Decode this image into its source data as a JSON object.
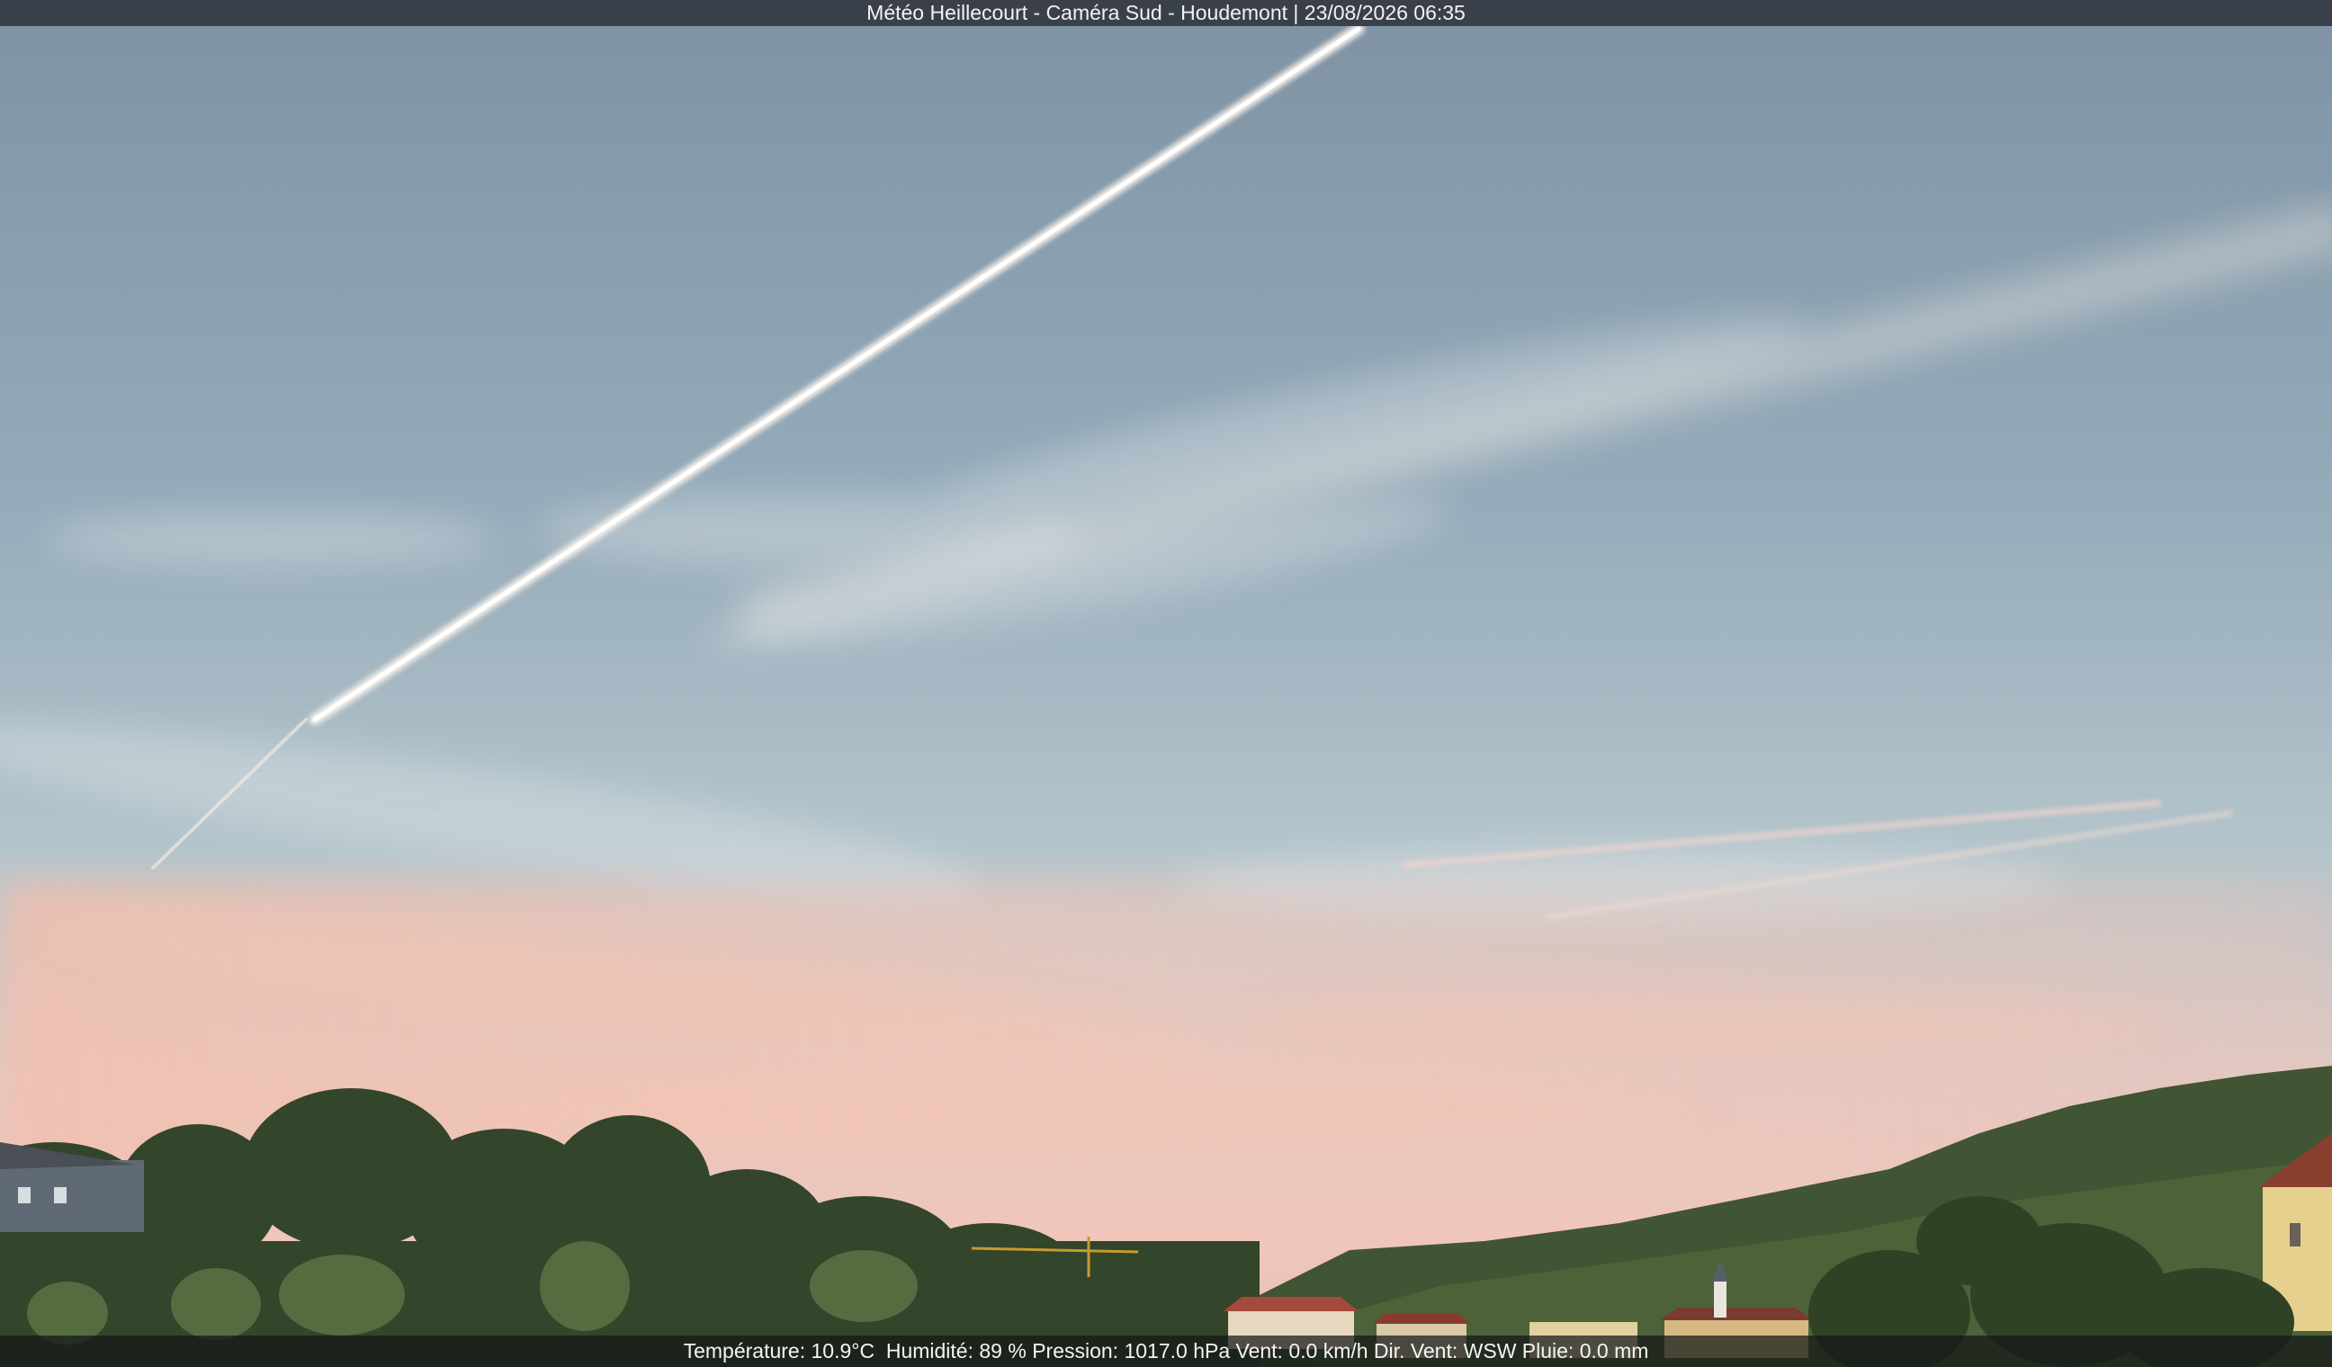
{
  "header": {
    "station": "Météo Heillecourt",
    "camera": "Caméra Sud",
    "location": "Houdemont",
    "datetime": "23/08/2026 06:35",
    "title": "Météo Heillecourt - Caméra Sud - Houdemont | 23/08/2026 06:35"
  },
  "weather": {
    "temperature_label": "Température:",
    "temperature_value": "10.9°C",
    "humidity_label": "Humidité:",
    "humidity_value": "89 %",
    "pressure_label": "Pression:",
    "pressure_value": "1017.0 hPa",
    "wind_label": "Vent:",
    "wind_value": "0.0 km/h",
    "wind_dir_label": "Dir. Vent:",
    "wind_dir_value": "WSW",
    "rain_label": "Pluie:",
    "rain_value": "0.0 mm",
    "line": "Température: 10.9°C  Humidité: 89 % Pression: 1017.0 hPa Vent: 0.0 km/h Dir. Vent: WSW Pluie: 0.0 mm"
  },
  "scene": {
    "sky_top_color": "#7f93a4",
    "sky_mid_color": "#a8bcc8",
    "sky_horizon_color": "#f0c4ba",
    "vegetation_color": "#3d4f2b",
    "contrail_color": "#f6eee6"
  }
}
